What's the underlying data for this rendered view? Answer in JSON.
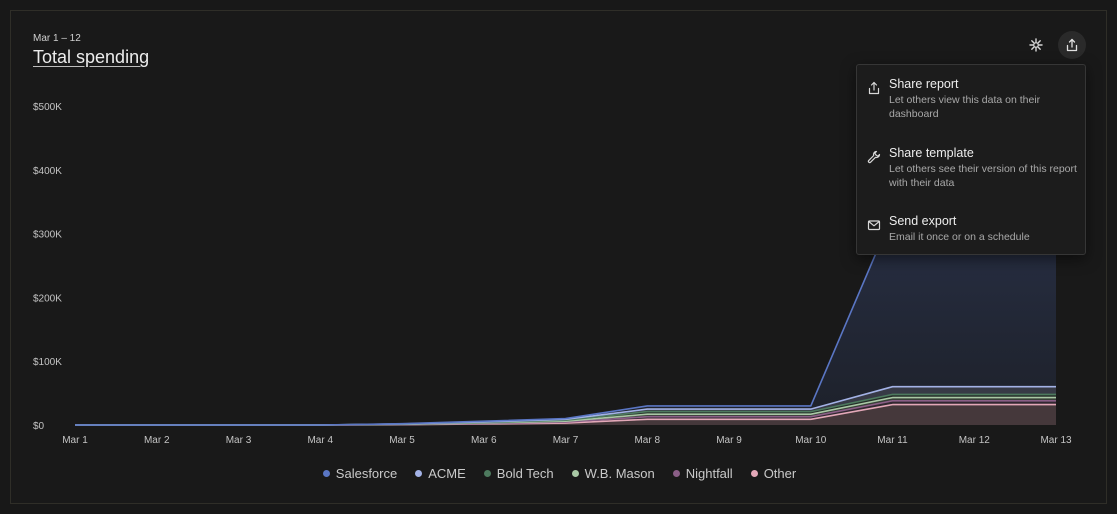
{
  "header": {
    "date_range": "Mar 1 – 12",
    "title": "Total spending"
  },
  "toolbar": {
    "sparkle_icon": "sparkle-icon",
    "share_icon": "share-icon"
  },
  "share_menu": {
    "items": [
      {
        "icon": "share-icon",
        "title": "Share report",
        "description": "Let others view this data on their dashboard"
      },
      {
        "icon": "wrench-icon",
        "title": "Share template",
        "description": "Let others see their version of this report with their data"
      },
      {
        "icon": "mail-icon",
        "title": "Send export",
        "description": "Email it once or on a schedule"
      }
    ]
  },
  "chart_data": {
    "type": "area",
    "stacked": true,
    "x": [
      "Mar 1",
      "Mar 2",
      "Mar 3",
      "Mar 4",
      "Mar 5",
      "Mar 6",
      "Mar 7",
      "Mar 8",
      "Mar 9",
      "Mar 10",
      "Mar 11",
      "Mar 12",
      "Mar 13"
    ],
    "y_ticks": [
      {
        "value": 0,
        "label": "$0"
      },
      {
        "value": 100000,
        "label": "$100K"
      },
      {
        "value": 200000,
        "label": "$200K"
      },
      {
        "value": 300000,
        "label": "$300K"
      },
      {
        "value": 400000,
        "label": "$400K"
      },
      {
        "value": 500000,
        "label": "$500K"
      }
    ],
    "ylim": [
      0,
      500000
    ],
    "grid": false,
    "legend_position": "bottom",
    "series": [
      {
        "name": "Other",
        "color": "#e3a8b8",
        "values": [
          0,
          0,
          0,
          0,
          500,
          1500,
          3000,
          9000,
          9000,
          9000,
          32000,
          32000,
          32000
        ]
      },
      {
        "name": "Nightfall",
        "color": "#8a5e86",
        "values": [
          0,
          0,
          0,
          0,
          300,
          800,
          1500,
          4000,
          4000,
          4000,
          6000,
          6000,
          6000
        ]
      },
      {
        "name": "W.B. Mason",
        "color": "#a9c8a5",
        "values": [
          0,
          0,
          0,
          0,
          300,
          800,
          1500,
          4000,
          4000,
          4000,
          5000,
          5000,
          5000
        ]
      },
      {
        "name": "Bold Tech",
        "color": "#4d7a5e",
        "values": [
          0,
          0,
          0,
          0,
          300,
          800,
          1500,
          4000,
          4000,
          4000,
          5000,
          5000,
          5000
        ]
      },
      {
        "name": "ACME",
        "color": "#a3b2e6",
        "values": [
          0,
          0,
          0,
          0,
          300,
          800,
          1500,
          4000,
          4000,
          4000,
          12000,
          12000,
          12000
        ]
      },
      {
        "name": "Salesforce",
        "color": "#5a76c4",
        "values": [
          0,
          0,
          0,
          0,
          300,
          1300,
          1000,
          5000,
          5000,
          5000,
          270000,
          300000,
          345000
        ]
      }
    ],
    "legend_order": [
      "Salesforce",
      "ACME",
      "Bold Tech",
      "W.B. Mason",
      "Nightfall",
      "Other"
    ]
  }
}
